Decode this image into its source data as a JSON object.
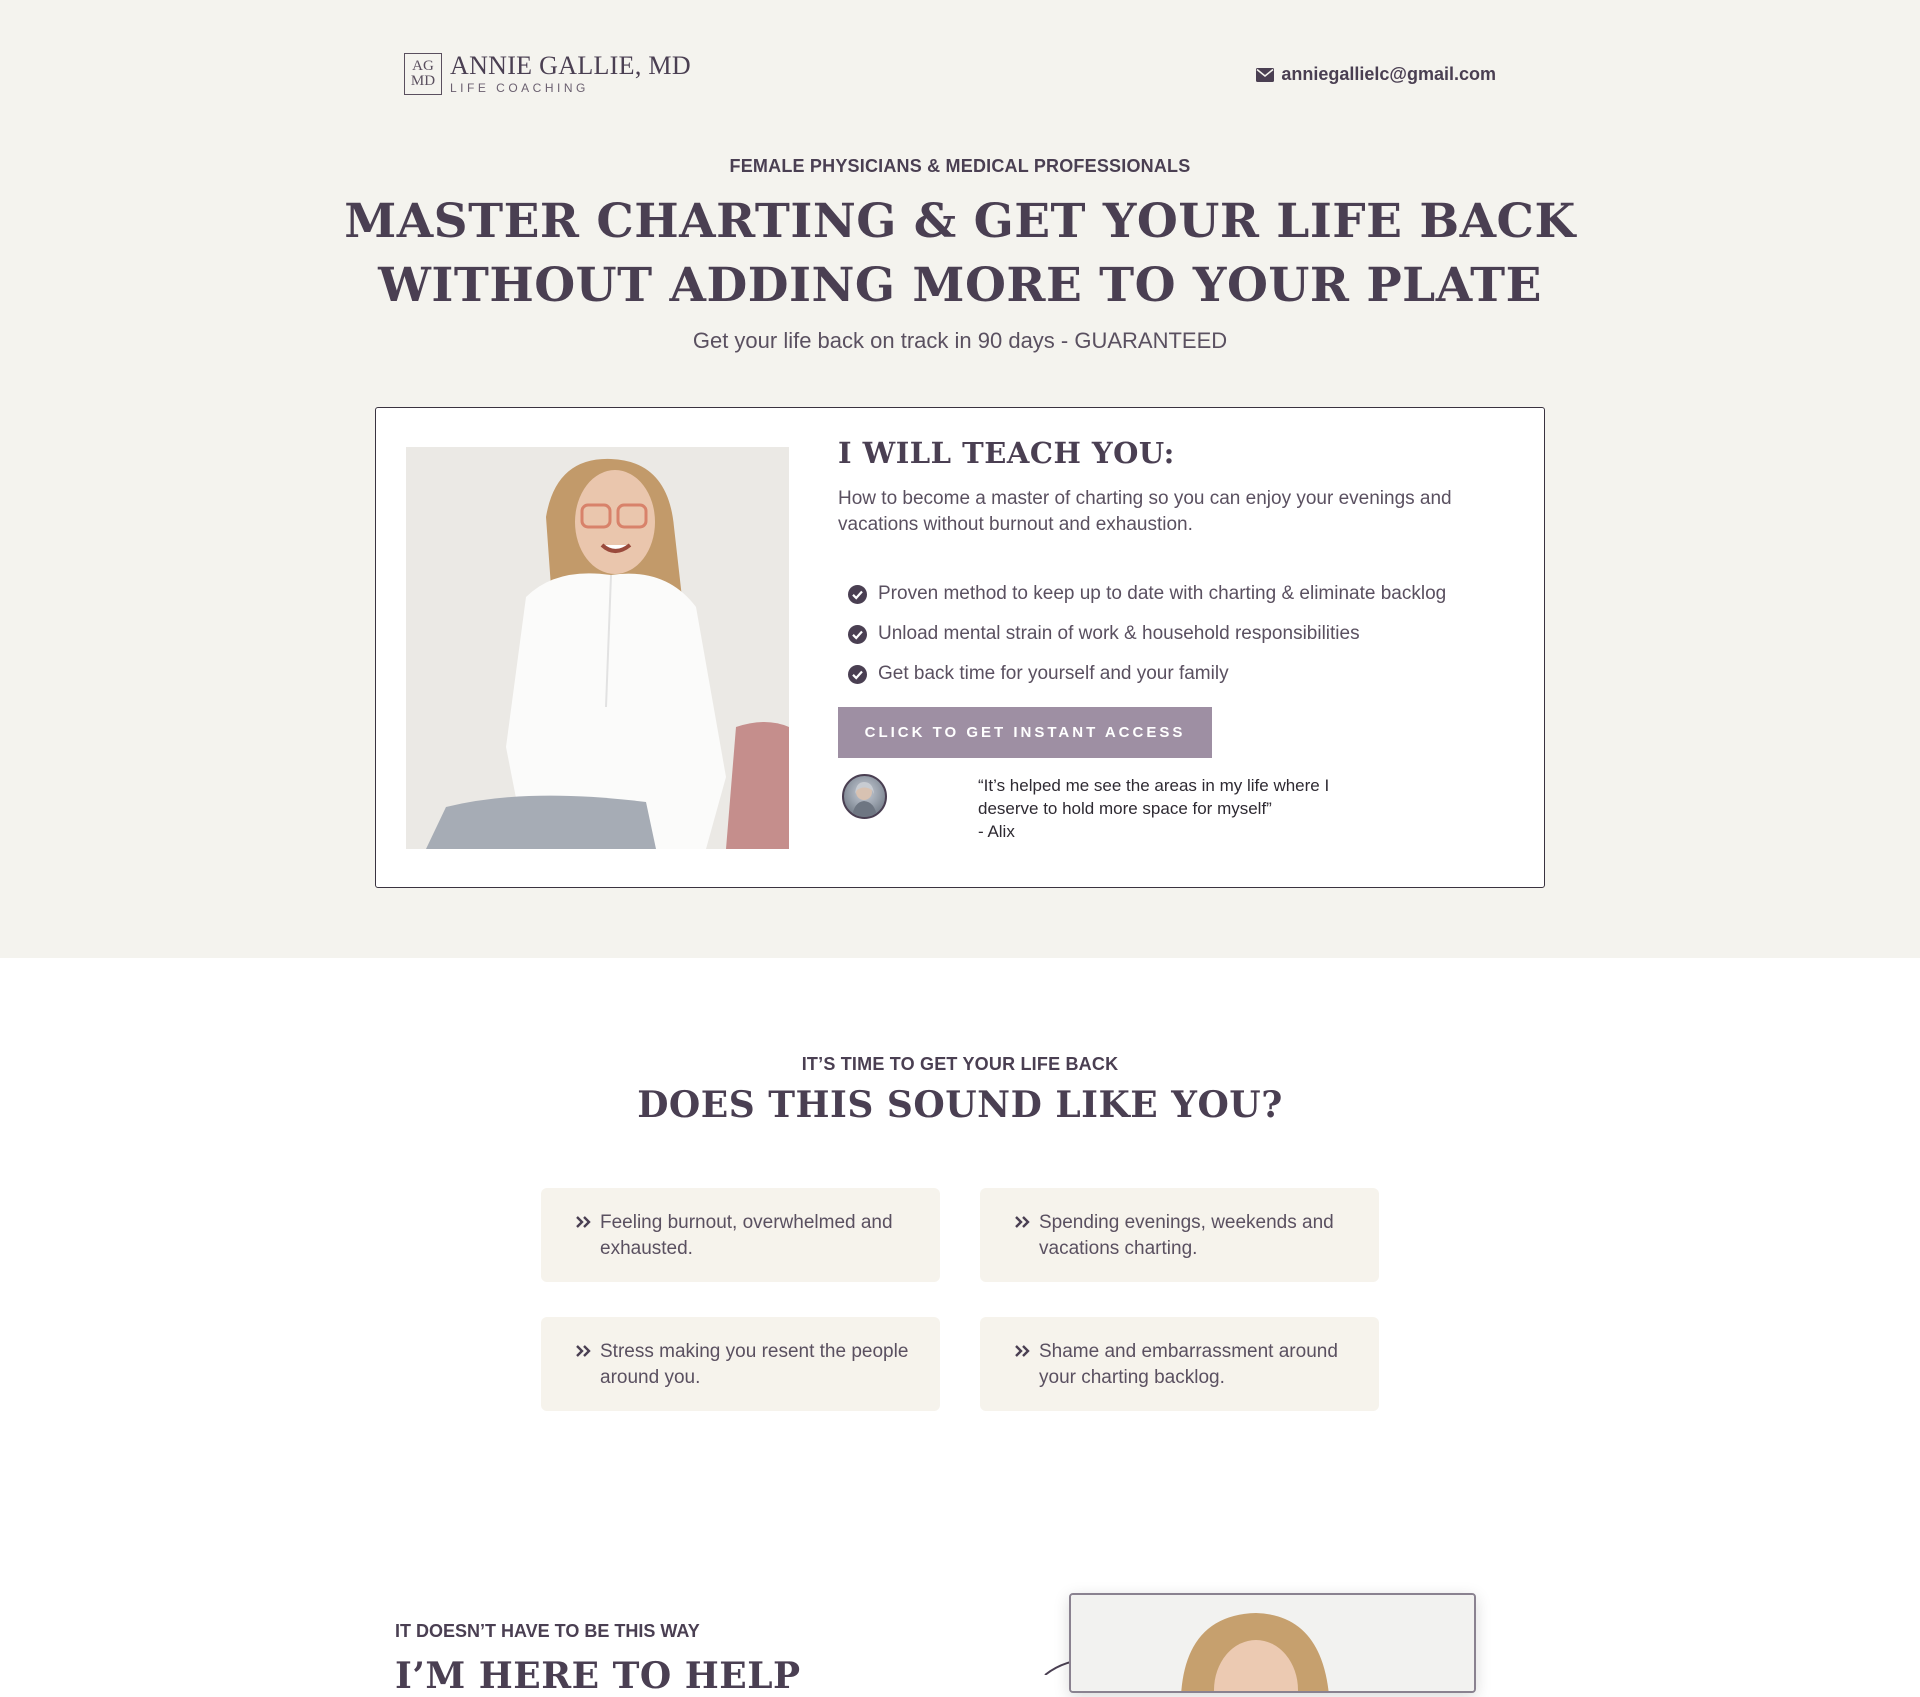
{
  "header": {
    "logo_mark_top": "AG",
    "logo_mark_bottom": "MD",
    "logo_name": "ANNIE GALLIE, MD",
    "logo_sub": "LIFE COACHING",
    "email": "anniegallielc@gmail.com"
  },
  "hero": {
    "eyebrow": "FEMALE PHYSICIANS & MEDICAL PROFESSIONALS",
    "title_line1": "MASTER CHARTING & GET YOUR LIFE BACK",
    "title_line2": "WITHOUT ADDING MORE TO YOUR PLATE",
    "subtitle": "Get your life back on track in 90 days - GUARANTEED"
  },
  "offer": {
    "title": "I WILL TEACH YOU:",
    "description": "How to become a master of charting so you can enjoy your evenings and vacations without burnout and exhaustion.",
    "benefits": [
      "Proven method to keep up to date with charting & eliminate backlog",
      "Unload mental strain of work & household responsibilities",
      "Get back time for yourself and your family"
    ],
    "cta_label": "CLICK TO GET INSTANT ACCESS",
    "testimonial_line1": "“It’s helped me see the areas in my life where I",
    "testimonial_line2": "deserve to hold more space for myself”",
    "testimonial_author": "- Alix"
  },
  "pain_section": {
    "eyebrow": "IT’S TIME TO GET YOUR LIFE BACK",
    "title": "DOES THIS SOUND LIKE YOU?",
    "items": [
      "Feeling burnout, overwhelmed and exhausted.",
      "Spending evenings, weekends and vacations charting.",
      "Stress making you resent the people around you.",
      "Shame and embarrassment around your charting backlog."
    ]
  },
  "help_section": {
    "eyebrow": "IT DOESN’T HAVE TO BE THIS WAY",
    "title": "I’M HERE TO HELP"
  },
  "colors": {
    "hero_bg": "#f4f3ee",
    "text_primary": "#4a3f52",
    "cta_bg": "#9e8fa3",
    "pain_card_bg": "#f6f3ec"
  },
  "icons": {
    "email": "envelope-icon",
    "benefit": "check-circle-icon",
    "pain": "double-chevron-right-icon"
  }
}
